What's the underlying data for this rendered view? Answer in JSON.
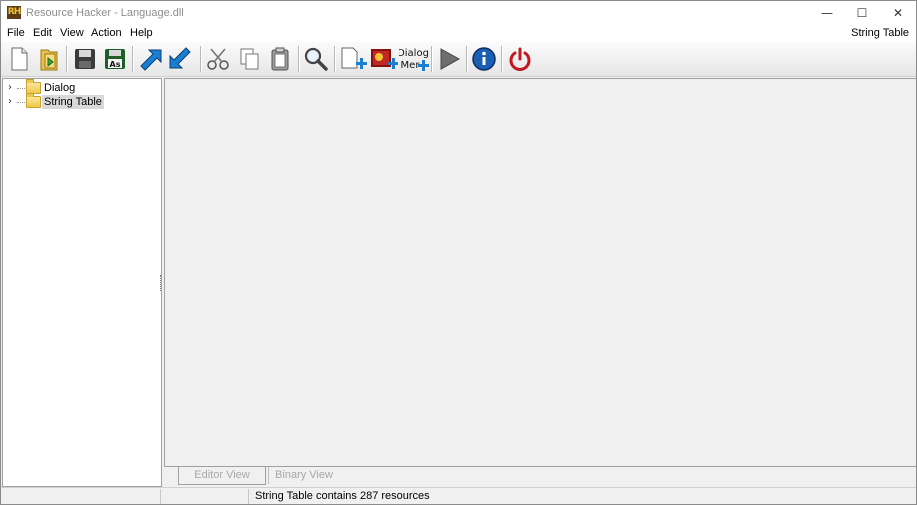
{
  "window": {
    "title": "Resource Hacker - Language.dll",
    "app_icon_text": "RH",
    "minimize_glyph": "—",
    "maximize_glyph": "☐",
    "close_glyph": "✕"
  },
  "menu": {
    "items": [
      "File",
      "Edit",
      "View",
      "Action",
      "Help"
    ],
    "right_label": "String Table"
  },
  "toolbar": {
    "buttons": [
      "new-file-icon",
      "open-file-icon",
      "save-icon",
      "save-as-icon",
      "import-arrow-icon",
      "export-arrow-icon",
      "cut-icon",
      "copy-icon",
      "paste-icon",
      "search-icon",
      "add-resource-icon",
      "add-image-resource-icon",
      "add-dialog-menu-icon",
      "compile-run-icon",
      "info-icon",
      "exit-power-icon"
    ],
    "save_as_badge": "As",
    "dialog_menu_label_line1": "Dialog",
    "dialog_menu_label_line2": "Mer"
  },
  "tree": {
    "nodes": [
      {
        "label": "Dialog",
        "expander": "›",
        "selected": false
      },
      {
        "label": "String Table",
        "expander": "›",
        "selected": true
      }
    ]
  },
  "editor": {
    "tabs": [
      "Editor View",
      "Binary View"
    ]
  },
  "status": {
    "message": "String Table contains 287 resources"
  },
  "colors": {
    "accent_blue": "#1a7fd1",
    "power_red": "#c0191f",
    "folder_yellow": "#eec84a"
  }
}
